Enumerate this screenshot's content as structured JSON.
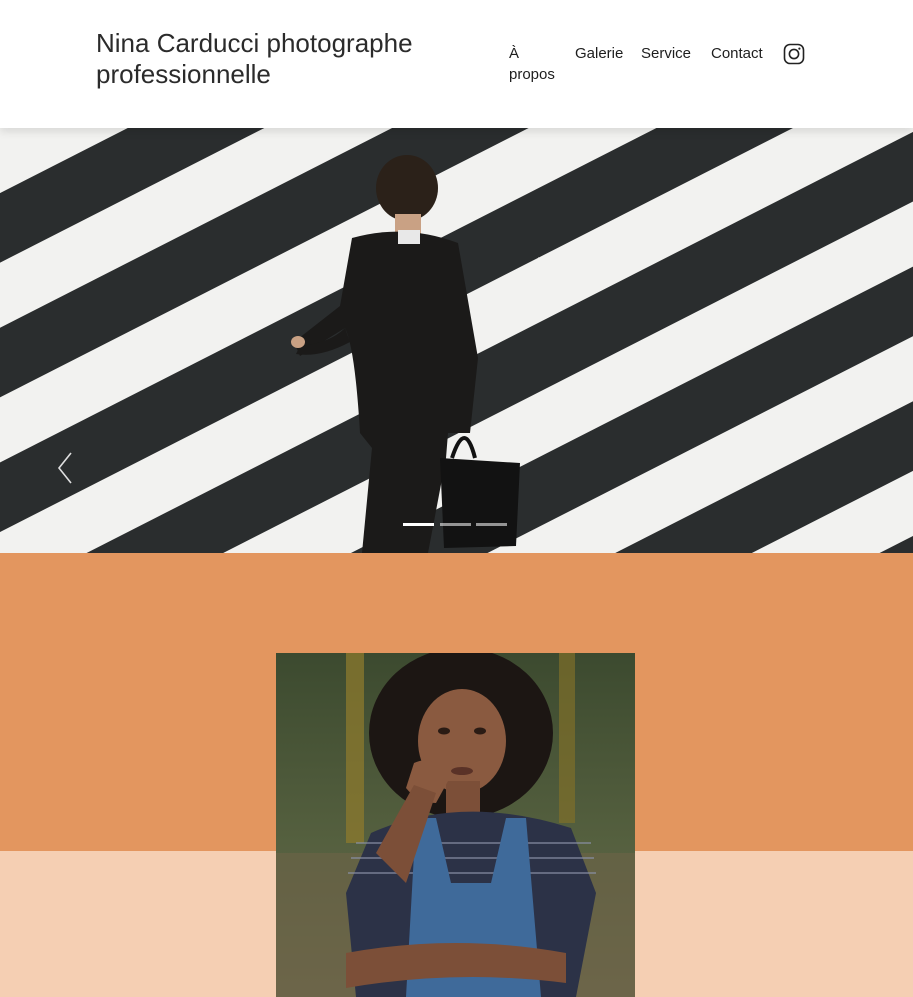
{
  "header": {
    "title": "Nina Carducci photographe professionnelle",
    "nav": {
      "about": "À propos",
      "gallery": "Galerie",
      "service": "Service",
      "contact": "Contact"
    },
    "social_icon": "instagram-icon"
  },
  "hero": {
    "slide_count": 3,
    "active_slide": 1,
    "prev_icon": "chevron-left-icon"
  },
  "colors": {
    "accent_orange": "#e3965f",
    "accent_peach": "#f5cfb3",
    "header_bg": "#ffffff"
  }
}
